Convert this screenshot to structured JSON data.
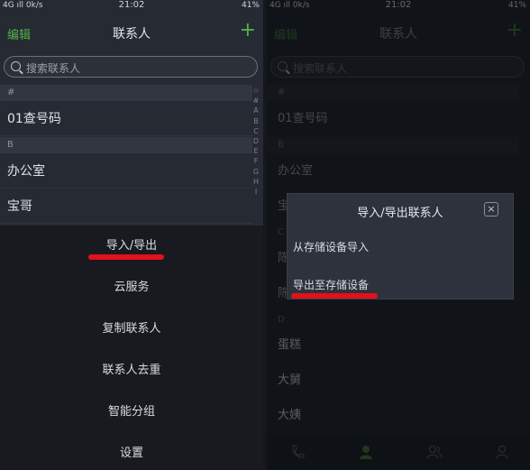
{
  "colors": {
    "accent": "#55b148",
    "highlight": "#e0121a"
  },
  "status": {
    "left": "4G ıll 0k/s",
    "time": "21:02",
    "right": "41%"
  },
  "header": {
    "edit": "编辑",
    "title": "联系人",
    "plus": "+"
  },
  "search": {
    "placeholder": "搜索联系人"
  },
  "contacts": {
    "sect_hash": "#",
    "row1": "01查号码",
    "sect_b": "B",
    "row2": "办公室",
    "row3": "宝哥",
    "sect_c": "C",
    "row4": "陈",
    "row5": "陈",
    "sect_d": "D",
    "row6": "蛋糕",
    "row7": "大舅",
    "row8": "大姨"
  },
  "index_letters": [
    "☆",
    "#",
    "A",
    "B",
    "C",
    "D",
    "E",
    "F",
    "G",
    "H",
    "I"
  ],
  "menu": {
    "import_export": "导入/导出",
    "cloud": "云服务",
    "copy": "复制联系人",
    "dedupe": "联系人去重",
    "smart_group": "智能分组",
    "settings": "设置"
  },
  "dialog": {
    "title": "导入/导出联系人",
    "close": "×",
    "import": "从存储设备导入",
    "export": "导出至存储设备"
  }
}
